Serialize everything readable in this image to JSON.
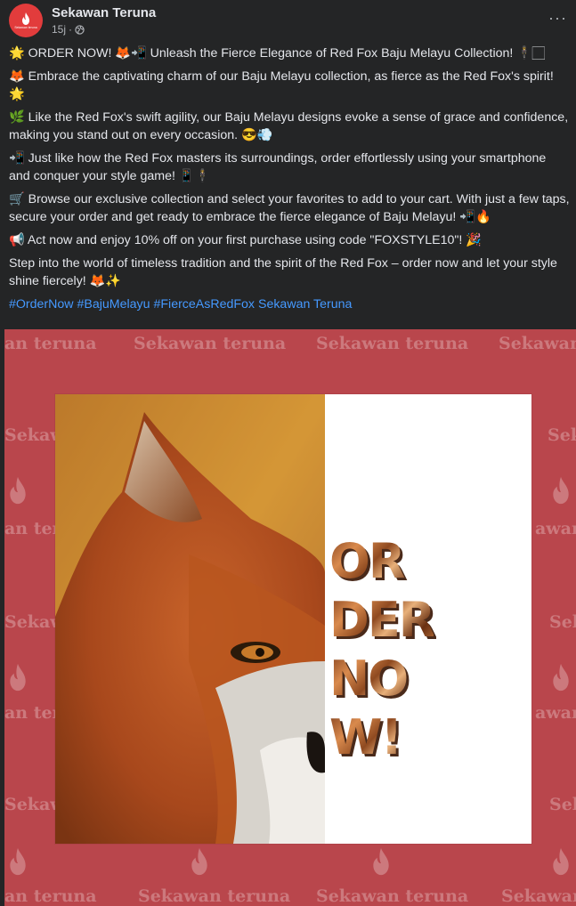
{
  "post": {
    "page_name": "Sekawan Teruna",
    "avatar_text": "Sekawan teruna",
    "time": "15j",
    "separator": "·",
    "more_label": "···",
    "paragraphs": [
      "🌟 ORDER NOW! 🦊📲 Unleash the Fierce Elegance of Red Fox Baju Melayu Collection! 🕴️🏻",
      "🦊 Embrace the captivating charm of our Baju Melayu collection, as fierce as the Red Fox's spirit! 🌟",
      "🌿 Like the Red Fox's swift agility, our Baju Melayu designs evoke a sense of grace and confidence, making you stand out on every occasion. 😎💨",
      "📲 Just like how the Red Fox masters its surroundings, order effortlessly using your smartphone and conquer your style game! 📱🕴️",
      "🛒 Browse our exclusive collection and select your favorites to add to your cart. With just a few taps, secure your order and get ready to embrace the fierce elegance of Baju Melayu! 📲🔥",
      "📢 Act now and enjoy 10% off on your first purchase using code \"FOXSTYLE10\"! 🎉",
      "Step into the world of timeless tradition and the spirit of the Red Fox – order now and let your style shine fiercely! 🦊✨"
    ],
    "hashtags": [
      "#OrderNow",
      "#BajuMelayu",
      "#FierceAsRedFox",
      "Sekawan Teruna"
    ]
  },
  "image": {
    "watermark_text": "Sekawan teruna",
    "partial_left": "an teruna",
    "partial_sek": "Sekawa",
    "partial_sek2": "Sek",
    "partial_wan": "awan",
    "partial_teru": "an teru",
    "order_lines": [
      "OR",
      "DER",
      "NO",
      "W!"
    ],
    "colors": {
      "background": "#b9464c",
      "card": "#ffffff",
      "accent": "#e23c3c"
    }
  }
}
